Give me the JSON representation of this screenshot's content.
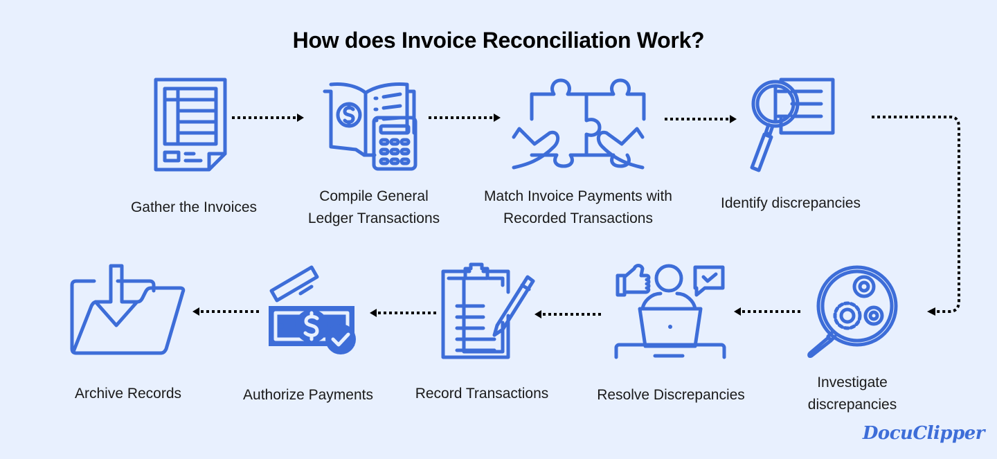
{
  "title": "How does Invoice Reconciliation Work?",
  "colors": {
    "background": "#E8F0FE",
    "icon": "#3D6DD8",
    "arrow": "#000000",
    "text": "#1A1A1A"
  },
  "steps": [
    {
      "order": 1,
      "label": "Gather the Invoices",
      "icon": "invoice-document-icon"
    },
    {
      "order": 2,
      "label": "Compile General\nLedger Transactions",
      "icon": "ledger-calculator-icon"
    },
    {
      "order": 3,
      "label": "Match Invoice Payments with\nRecorded Transactions",
      "icon": "puzzle-hands-icon"
    },
    {
      "order": 4,
      "label": "Identify discrepancies",
      "icon": "magnifier-document-icon"
    },
    {
      "order": 5,
      "label": "Investigate\ndiscrepancies",
      "icon": "magnifier-gears-icon"
    },
    {
      "order": 6,
      "label": "Resolve Discrepancies",
      "icon": "person-laptop-feedback-icon"
    },
    {
      "order": 7,
      "label": "Record Transactions",
      "icon": "clipboard-pencil-icon"
    },
    {
      "order": 8,
      "label": "Authorize Payments",
      "icon": "money-card-check-icon"
    },
    {
      "order": 9,
      "label": "Archive Records",
      "icon": "folder-download-icon"
    }
  ],
  "brand": "DocuClipper"
}
